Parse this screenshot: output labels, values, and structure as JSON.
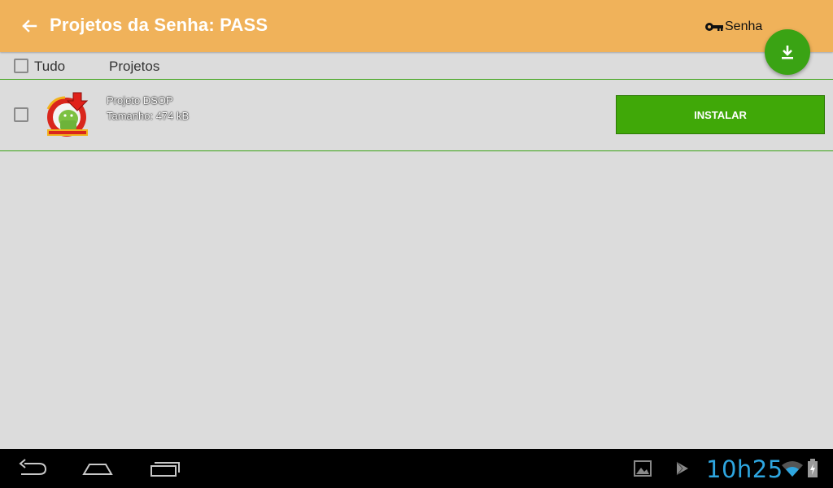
{
  "app_bar": {
    "title": "Projetos da Senha: PASS",
    "password_action_label": "Senha",
    "icons": {
      "back": "arrow-back-icon",
      "password": "key-icon",
      "fab": "download-icon"
    }
  },
  "list_header": {
    "select_all_label": "Tudo",
    "column_label": "Projetos"
  },
  "projects": [
    {
      "name": "Projeto DSOP",
      "size": "Tamanho: 474 kB",
      "action_label": "INSTALAR",
      "icon": "class-installer-logo"
    }
  ],
  "system_bar": {
    "time": "10h25",
    "icons": [
      "back-icon",
      "home-icon",
      "recents-icon",
      "gallery-notification-icon",
      "play-store-notification-icon",
      "wifi-icon",
      "battery-charging-icon"
    ]
  },
  "colors": {
    "app_bar": "#f0b25a",
    "accent_green": "#3aa314",
    "background": "#dcdcdc",
    "clock": "#2ea6e0"
  }
}
